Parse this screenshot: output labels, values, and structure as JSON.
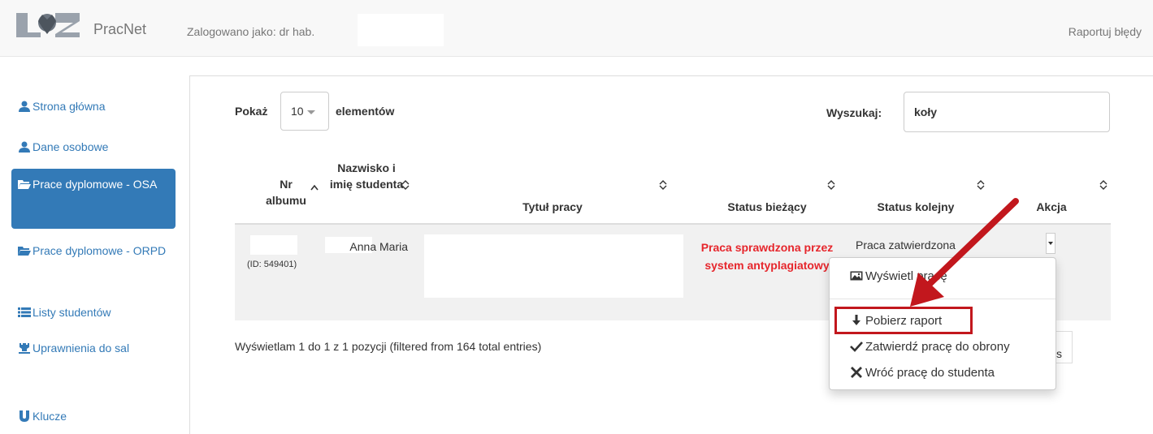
{
  "header": {
    "brand": "PracNet",
    "logged_in": "Zalogowano jako: dr hab.",
    "report_bugs": "Raportuj błędy"
  },
  "sidebar": {
    "items": [
      {
        "label": "Strona główna",
        "icon": "user-icon"
      },
      {
        "label": "Dane osobowe",
        "icon": "user-icon"
      },
      {
        "label": "Prace dyplomowe - OSA",
        "icon": "folder-open-icon",
        "active": true
      },
      {
        "label": "Prace dyplomowe - ORPD",
        "icon": "folder-open-icon"
      },
      {
        "label": "Listy studentów",
        "icon": "list-icon"
      },
      {
        "label": "Uprawnienia do sal",
        "icon": "tower-icon"
      },
      {
        "label": "Klucze",
        "icon": "magnet-icon"
      }
    ]
  },
  "controls": {
    "show_label": "Pokaż",
    "page_size": "10",
    "elements_label": "elementów",
    "search_label": "Wyszukaj:",
    "search_value": "koły"
  },
  "table": {
    "columns": [
      "Nr albumu",
      "Nazwisko i imię studenta",
      "Tytuł pracy",
      "Status bieżący",
      "Status kolejny",
      "Akcja"
    ],
    "rows": [
      {
        "id": "(ID: 549401)",
        "name": "Anna Maria",
        "status_current": "Praca sprawdzona przez system antyplagiatowy",
        "status_next": "Praca zatwierdzona"
      }
    ],
    "info": "Wyświetlam 1 do 1 z 1 pozycji (filtered from 164 total entries)",
    "paging_fragment": "s"
  },
  "dropdown": {
    "items": [
      {
        "label": "Wyświetl pracę",
        "icon": "picture-icon"
      },
      {
        "label": "Pobierz raport",
        "icon": "download-icon"
      },
      {
        "label": "Zatwierdź pracę do obrony",
        "icon": "check-icon"
      },
      {
        "label": "Wróć pracę do studenta",
        "icon": "x-icon"
      }
    ]
  },
  "colors": {
    "accent": "#337ab7",
    "status_red": "#e6262c",
    "annotation_red": "#c2171d"
  }
}
